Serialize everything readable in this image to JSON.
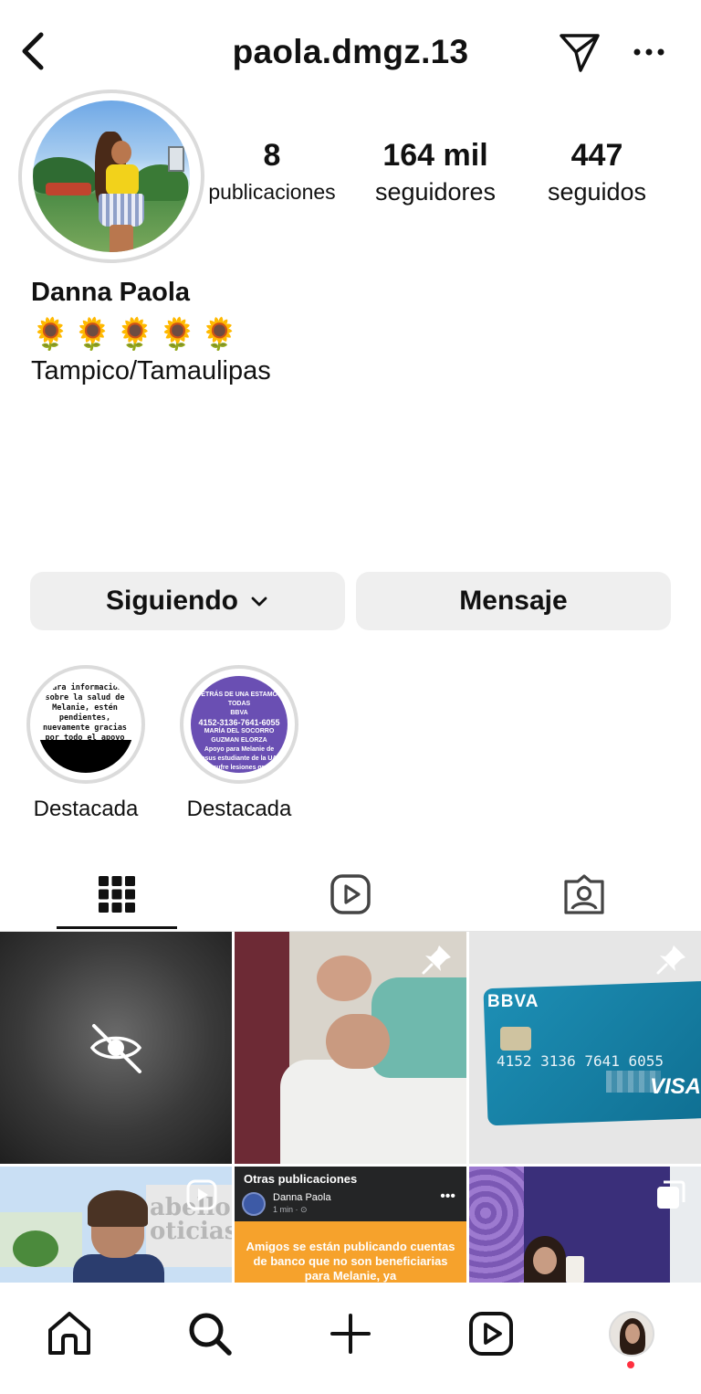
{
  "header": {
    "username": "paola.dmgz.13"
  },
  "stats": {
    "posts_count": "8",
    "posts_label": "publicaciones",
    "followers_count": "164 mil",
    "followers_label": "seguidores",
    "following_count": "447",
    "following_label": "seguidos"
  },
  "bio": {
    "name": "Danna Paola",
    "emojis": "🌻🌻🌻🌻🌻",
    "location": "Tampico/Tamaulipas"
  },
  "actions": {
    "following_label": "Siguiendo",
    "message_label": "Mensaje"
  },
  "highlights": [
    {
      "label": "Destacada",
      "cover_text": "para información sobre la salud de Melanie, estén pendientes, nuevamente gracias por todo el apoyo"
    },
    {
      "label": "Destacada",
      "cover_header": "DETRÁS DE UNA ESTAMOS TODAS",
      "cover_bank": "BBVA",
      "cover_account": "4152-3136-7641-6055",
      "cover_holder": "MARÍA DEL SOCORRO GUZMAN ELORZA",
      "cover_note": "Apoyo para Melanie de Jesus estudiante de la UAT que sufre lesiones graves"
    }
  ],
  "tabs": [
    {
      "icon": "grid-icon",
      "active": true
    },
    {
      "icon": "reels-icon",
      "active": false
    },
    {
      "icon": "tagged-icon",
      "active": false
    }
  ],
  "posts": {
    "card_bank": "BBVA",
    "card_number": "4152 3136 7641 6055",
    "card_brand": "VISA",
    "news_watermark": "abello\noticias",
    "fb_section_title": "Otras publicaciones",
    "fb_author": "Danna Paola",
    "fb_time": "1 min · ⊙",
    "fb_banner_text": "Amigos se están publicando cuentas de banco que no son beneficiarias para Melanie, ya"
  },
  "nav": [
    "home-icon",
    "search-icon",
    "create-icon",
    "reels-icon",
    "profile-avatar"
  ],
  "colors": {
    "button_bg": "#efefef",
    "notification_dot": "#ff3040",
    "fb_banner": "#f6a22c"
  }
}
